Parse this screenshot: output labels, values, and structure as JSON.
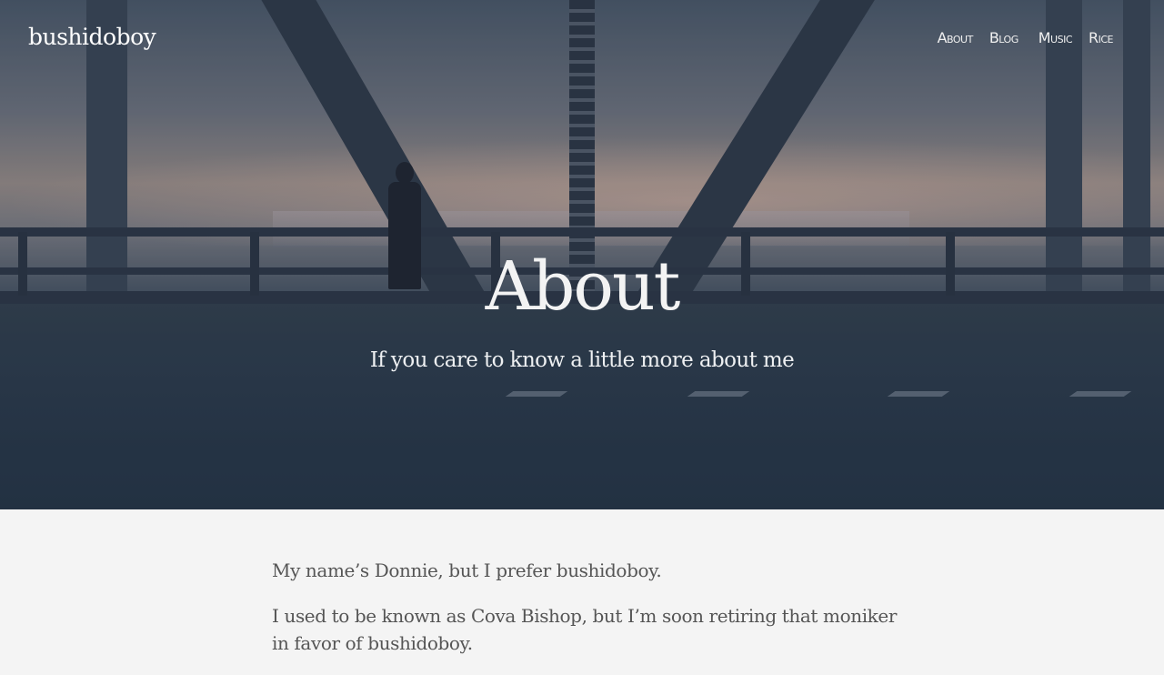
{
  "site": {
    "logo": "bushidoboy"
  },
  "nav": {
    "items": [
      {
        "label": "About"
      },
      {
        "label": "Blog"
      },
      {
        "label": "Music"
      },
      {
        "label": "Rice"
      }
    ]
  },
  "hero": {
    "title": "About",
    "subtitle": "If you care to know a little more about me"
  },
  "content": {
    "paragraphs": [
      "My name’s Donnie, but I prefer bushidoboy.",
      "I used to be known as Cova Bishop, but I’m soon retiring that moniker in favor of bushidoboy."
    ]
  },
  "colors": {
    "page_background": "#f4f4f4",
    "hero_text": "#f3f3f3",
    "body_text": "#555555"
  }
}
